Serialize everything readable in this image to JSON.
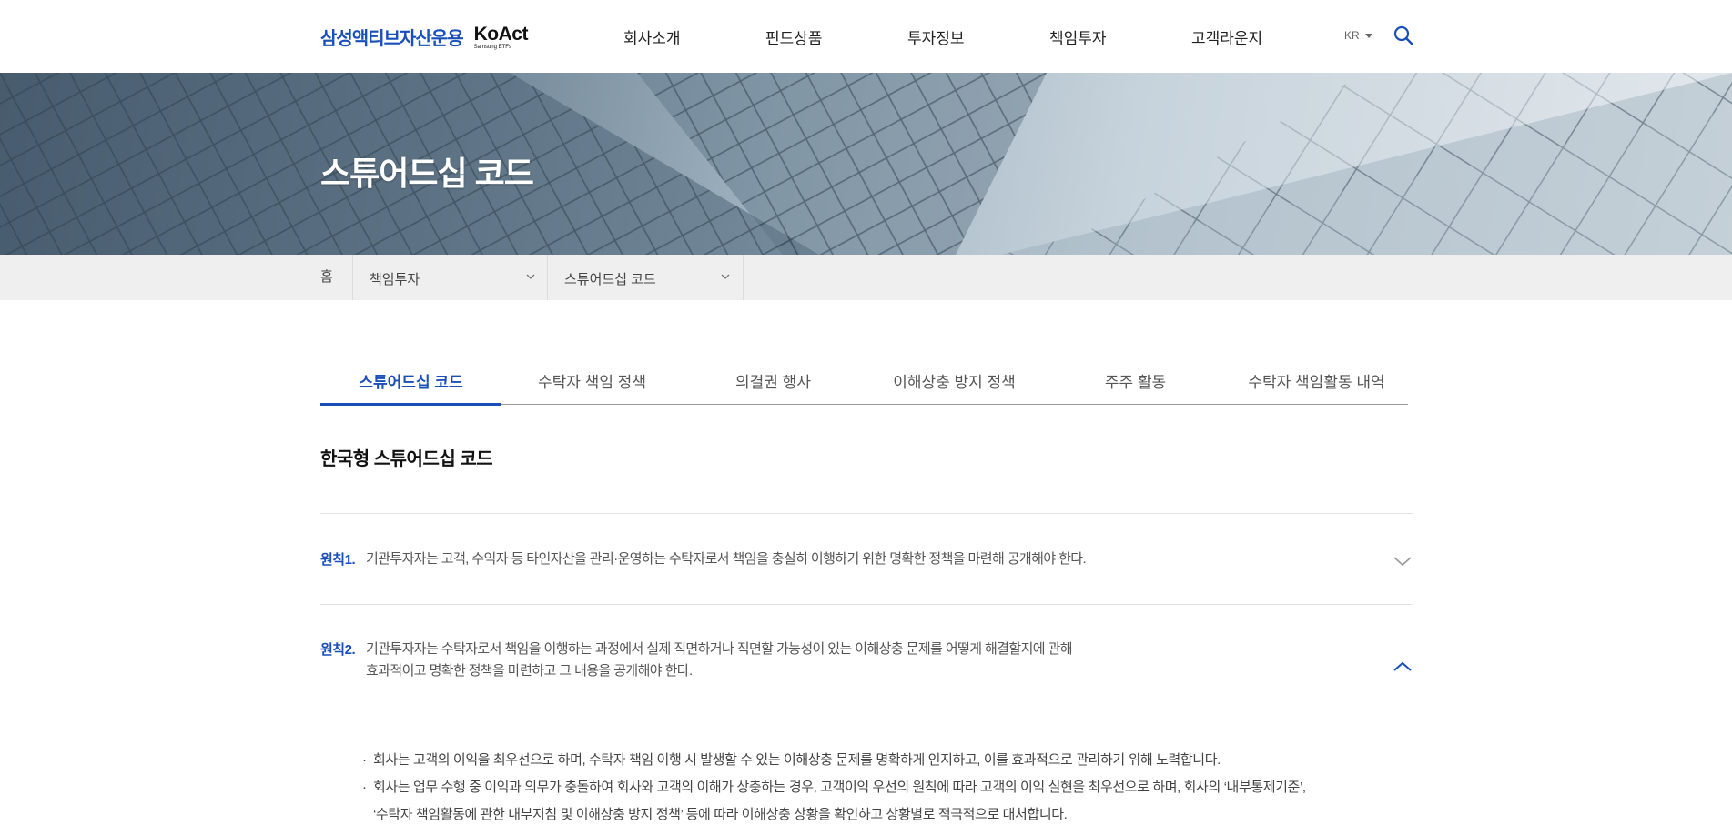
{
  "header": {
    "logo_ko": "삼성액티브자산운용",
    "logo_en": "KoAct",
    "logo_en_sub": "Samsung ETFs",
    "nav": [
      "회사소개",
      "펀드상품",
      "투자정보",
      "책임투자",
      "고객라운지"
    ],
    "lang": "KR",
    "search_icon": "search-icon"
  },
  "hero": {
    "title": "스튜어드십 코드"
  },
  "breadcrumb": {
    "home": "홈",
    "level1": "책임투자",
    "level2": "스튜어드십 코드"
  },
  "tabs": [
    "스튜어드십 코드",
    "수탁자 책임 정책",
    "의결권 행사",
    "이해상충 방지 정책",
    "주주 활동",
    "수탁자 책임활동 내역"
  ],
  "active_tab": "스튜어드십 코드",
  "section_title": "한국형 스튜어드십 코드",
  "principles": [
    {
      "label": "원칙1.",
      "text": "기관투자자는 고객, 수익자 등 타인자산을 관리·운영하는 수탁자로서 책임을 충실히 이행하기 위한 명확한 정책을 마련해 공개해야 한다.",
      "expanded": false
    },
    {
      "label": "원칙2.",
      "text_line1": "기관투자자는 수탁자로서 책임을 이행하는 과정에서 실제 직면하거나 직면할 가능성이 있는 이해상충 문제를 어떻게 해결할지에 관해",
      "text_line2": "효과적이고 명확한 정책을 마련하고 그 내용을 공개해야 한다.",
      "expanded": true,
      "details": [
        "회사는 고객의 이익을 최우선으로 하며, 수탁자 책임 이행 시 발생할 수 있는 이해상충 문제를 명확하게 인지하고, 이를 효과적으로 관리하기 위해 노력합니다.",
        "회사는 업무 수행 중 이익과 의무가 충돌하여 회사와 고객의 이해가 상충하는 경우, 고객이익 우선의 원칙에 따라 고객의 이익 실현을 최우선으로 하며, 회사의 ‘내부통제기준’,"
      ],
      "detail_cont": "‘수탁자 책임활동에 관한 내부지침 및 이해상충 방지 정책’ 등에 따라 이해상충 상황을 확인하고 상황별로 적극적으로 대처합니다."
    }
  ],
  "colors": {
    "accent": "#1a4fba",
    "crumb_bg": "#efefef"
  }
}
